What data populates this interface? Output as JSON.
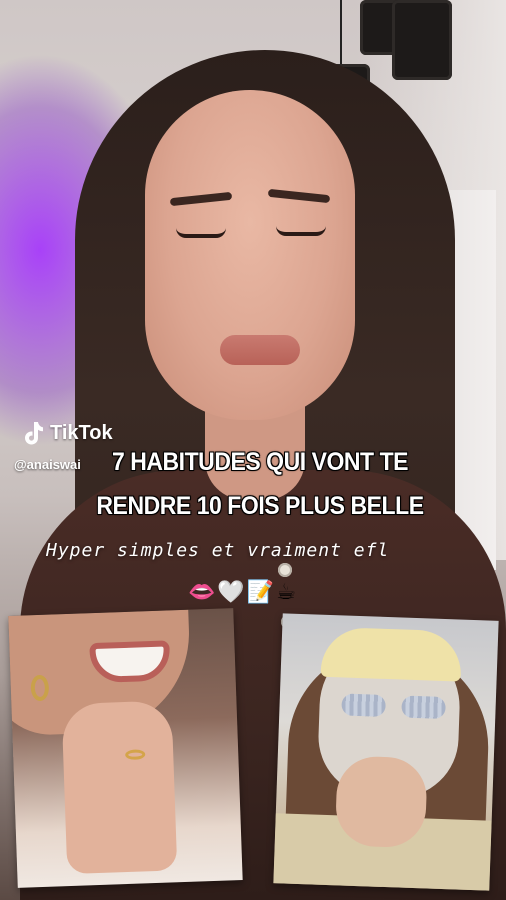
{
  "app": {
    "logo_icon": "tiktok-note-icon",
    "brand": "TikTok"
  },
  "overlay": {
    "handle": "@anaiswai",
    "headline_line1": "7 HABITUDES QUI VONT TE",
    "headline_line2": "RENDRE 10 FOIS PLUS BELLE",
    "subtitle": "Hyper simples et vraiment efl",
    "emojis": "👄🤍📝☕"
  },
  "colors": {
    "accent_purple": "#a020ff",
    "text": "#ffffff"
  }
}
